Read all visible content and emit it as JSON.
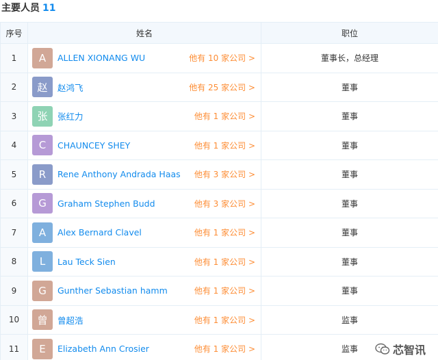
{
  "header": {
    "title": "主要人员",
    "count": "11"
  },
  "table": {
    "columns": [
      "序号",
      "姓名",
      "职位"
    ],
    "rows": [
      {
        "index": "1",
        "avatar": "A",
        "avatar_color": "#d1a796",
        "name": "ALLEN XIONANG WU",
        "companies": "他有 10 家公司 >",
        "position": "董事长，总经理"
      },
      {
        "index": "2",
        "avatar": "赵",
        "avatar_color": "#8a9bc9",
        "name": "赵鸿飞",
        "companies": "他有 25 家公司 >",
        "position": "董事"
      },
      {
        "index": "3",
        "avatar": "张",
        "avatar_color": "#8fd3b4",
        "name": "张红力",
        "companies": "他有 1 家公司 >",
        "position": "董事"
      },
      {
        "index": "4",
        "avatar": "C",
        "avatar_color": "#b69ad6",
        "name": "CHAUNCEY SHEY",
        "companies": "他有 1 家公司 >",
        "position": "董事"
      },
      {
        "index": "5",
        "avatar": "R",
        "avatar_color": "#8a9bc9",
        "name": "Rene Anthony Andrada Haas",
        "companies": "他有 3 家公司 >",
        "position": "董事"
      },
      {
        "index": "6",
        "avatar": "G",
        "avatar_color": "#b69ad6",
        "name": "Graham Stephen Budd",
        "companies": "他有 3 家公司 >",
        "position": "董事"
      },
      {
        "index": "7",
        "avatar": "A",
        "avatar_color": "#7fb0de",
        "name": "Alex Bernard Clavel",
        "companies": "他有 1 家公司 >",
        "position": "董事"
      },
      {
        "index": "8",
        "avatar": "L",
        "avatar_color": "#7fb0de",
        "name": "Lau Teck Sien",
        "companies": "他有 1 家公司 >",
        "position": "董事"
      },
      {
        "index": "9",
        "avatar": "G",
        "avatar_color": "#d1a796",
        "name": "Gunther Sebastian hamm",
        "companies": "他有 1 家公司 >",
        "position": "董事"
      },
      {
        "index": "10",
        "avatar": "曾",
        "avatar_color": "#d1a796",
        "name": "曾超浩",
        "companies": "他有 1 家公司 >",
        "position": "监事"
      },
      {
        "index": "11",
        "avatar": "E",
        "avatar_color": "#d1a796",
        "name": "Elizabeth Ann Crosier",
        "companies": "他有 1 家公司 >",
        "position": "监事"
      }
    ]
  },
  "watermark": {
    "text": "芯智讯",
    "icon": "wechat-icon"
  }
}
